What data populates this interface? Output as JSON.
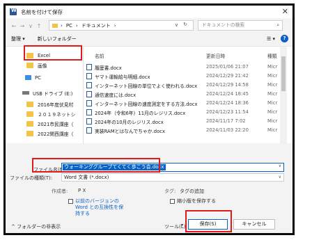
{
  "window": {
    "title": "名前を付けて保存"
  },
  "address": {
    "back": "←",
    "forward": "→",
    "up_dropdown": "∨",
    "up": "↑",
    "crumbs": [
      "PC",
      "ドキュメント"
    ],
    "search_placeholder": "ドキュメントの検索"
  },
  "toolbar": {
    "organize": "整理 ▾",
    "new_folder": "新しいフォルダー",
    "view": "☰ ▾",
    "help": "?"
  },
  "nav": {
    "items": [
      "Excel",
      "画像",
      "PC",
      "USB ドライブ (E:)",
      "2016年度伏見村",
      "２０１９ネットシ",
      "2021市民講座（",
      "2022関西講座（"
    ]
  },
  "columns": {
    "name": "名前",
    "date": "更新日時",
    "type": "種類"
  },
  "files": [
    {
      "name": "履歴書.docx",
      "date": "2025/01/06 21:07",
      "type": "Micr"
    },
    {
      "name": "ヤマト運輸給与明細.docx",
      "date": "2024/12/29 21:42",
      "type": "Micr"
    },
    {
      "name": "インターネット回線の単位でよく使われる.docx",
      "date": "2024/12/29 14:58",
      "type": "Micr"
    },
    {
      "name": "通信速度には.docx",
      "date": "2024/12/24 18:45",
      "type": "Micr"
    },
    {
      "name": "インターネット回線の速度測定をする方法.docx",
      "date": "2024/12/24 18:36",
      "type": "Micr"
    },
    {
      "name": "2024年（令和6年）11月のレジリス.docx",
      "date": "2024/12/23 11:54",
      "type": "Micr"
    },
    {
      "name": "2024年の10月のレジリス.docx",
      "date": "2024/11/17 7:02",
      "type": "Micr"
    },
    {
      "name": "実装RAMとはなんでちゃか.docx",
      "date": "2024/11/03 22:20",
      "type": "Micr"
    }
  ],
  "form": {
    "filename_label": "ファイル名(N):",
    "filename_value": "ウォーキンググループてくてく歩こう会.docx",
    "filetype_label": "ファイルの種類(T):",
    "filetype_value": "Word 文書 (*.docx)",
    "author_label": "作成者:",
    "author_value": "P X",
    "tag_label": "タグ:",
    "tag_value": "タグの追加",
    "compat_lines": [
      "以前のバージョンの",
      "Word との互換性を保",
      "持する"
    ],
    "thumb_label": "縮小版を保存する"
  },
  "footer": {
    "hide_folders": "フォルダーの非表示",
    "tools": "ツール(L)",
    "save": "保存(S)",
    "cancel": "キャンセル"
  },
  "highlight_color": "#e11b1b"
}
